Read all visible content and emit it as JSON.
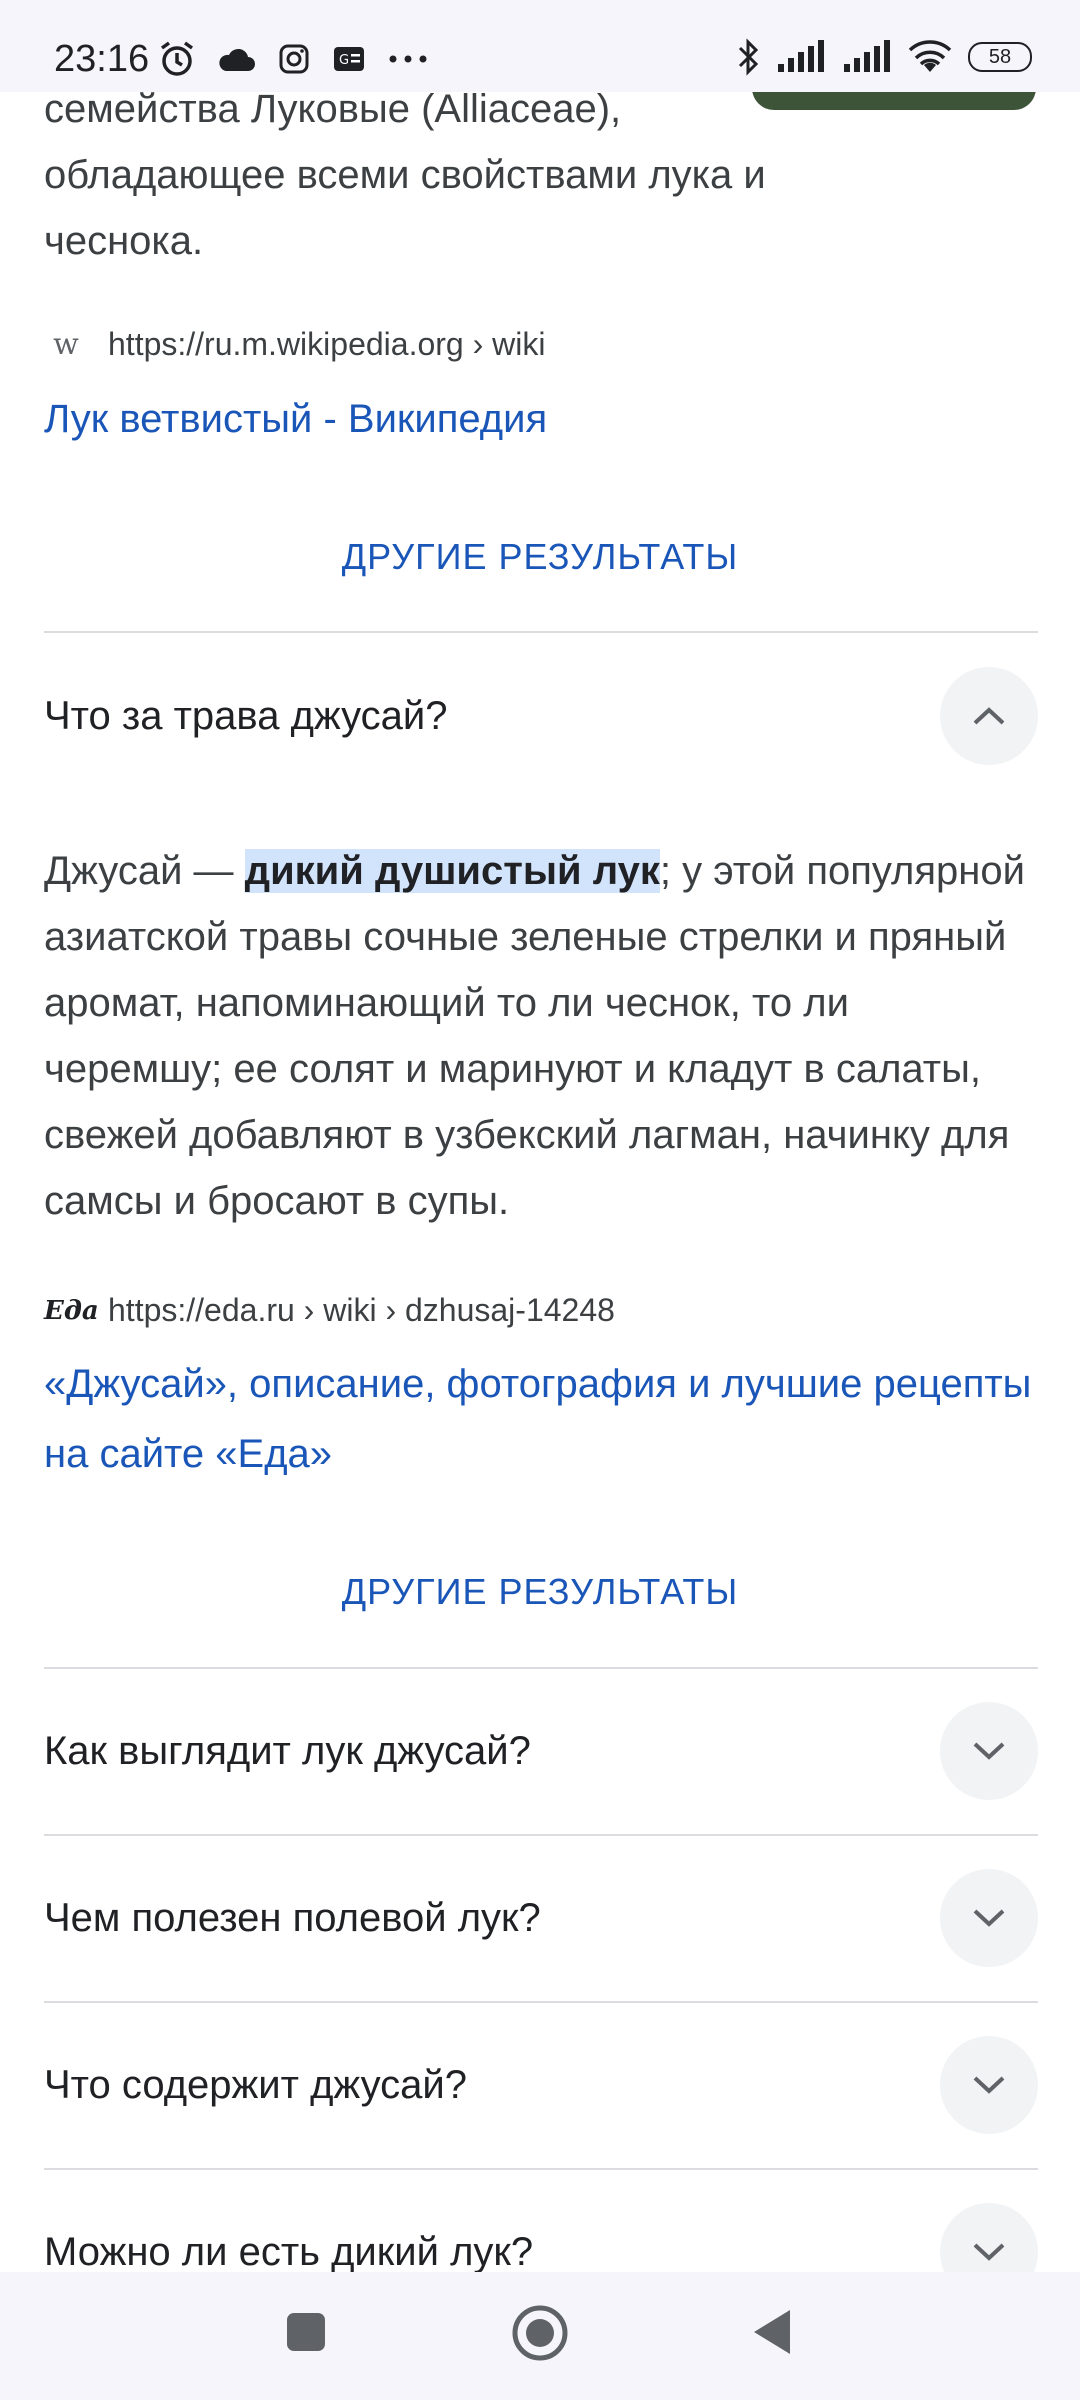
{
  "status_bar": {
    "time": "23:16",
    "battery": "58"
  },
  "snippet1": {
    "text_line1": "семейства Луковые (Alliaceae),",
    "text_line2": "обладающее всеми свойствами лука и",
    "text_line3": "чеснока.",
    "favicon": "w",
    "url": "https://ru.m.wikipedia.org › wiki",
    "title": "Лук ветвистый - Википедия"
  },
  "more_results_label": "ДРУГИЕ РЕЗУЛЬТАТЫ",
  "faq_open": {
    "question": "Что за трава джусай?",
    "answer_prefix": "Джусай — ",
    "answer_highlight": "дикий душистый лук",
    "answer_rest": "; у этой популярной азиатской травы сочные зеленые стрелки и пряный аромат, напоминающий то ли чеснок, то ли черемшу; ее солят и маринуют и кладут в салаты, свежей добавляют в узбекский лагман, начинку для самсы и бросают в супы.",
    "favicon": "Еда",
    "url": "https://eda.ru › wiki › dzhusaj-14248",
    "title": "«Джусай», описание, фотография и лучшие рецепты на сайте «Еда»"
  },
  "faq_collapsed": [
    {
      "question": "Как выглядит лук джусай?"
    },
    {
      "question": "Чем полезен полевой лук?"
    },
    {
      "question": "Что содержит джусай?"
    },
    {
      "question": "Можно ли есть дикий лук?"
    }
  ],
  "icons": {
    "status": [
      "alarm-icon",
      "cloud-icon",
      "instagram-icon",
      "news-icon",
      "more-icon"
    ],
    "status_right": [
      "bluetooth-icon",
      "signal-icon",
      "signal-icon",
      "wifi-icon",
      "battery-icon"
    ],
    "nav": [
      "recents-icon",
      "home-icon",
      "back-icon"
    ]
  },
  "colors": {
    "link": "#1a56b8",
    "highlight": "#d2e3fc",
    "chevron_bg": "#f1f3f4"
  }
}
